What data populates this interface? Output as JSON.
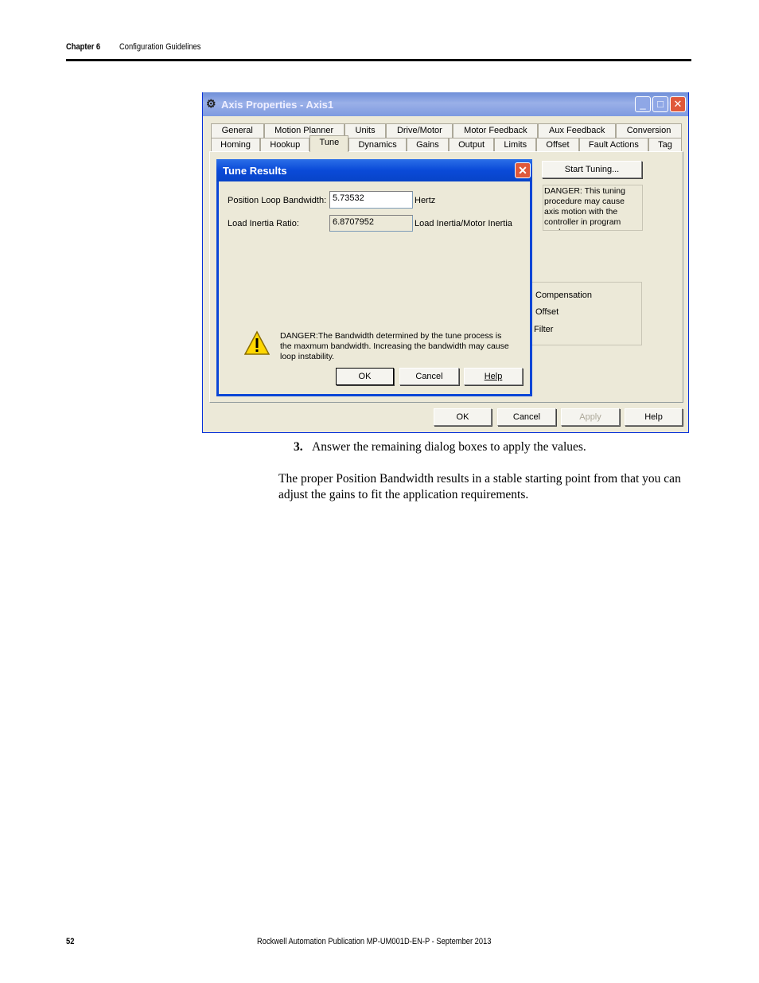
{
  "header": {
    "chapter": "Chapter 6",
    "section": "Configuration Guidelines"
  },
  "window": {
    "title": "Axis Properties - Axis1",
    "tabs_row1": [
      "General",
      "Motion Planner",
      "Units",
      "Drive/Motor",
      "Motor Feedback",
      "Aux Feedback",
      "Conversion"
    ],
    "tabs_row2": [
      "Homing",
      "Hookup",
      "Tune",
      "Dynamics",
      "Gains",
      "Output",
      "Limits",
      "Offset",
      "Fault Actions",
      "Tag"
    ],
    "selected_tab": "Tune",
    "start_tuning": "Start Tuning...",
    "danger_note": "DANGER: This tuning procedure may cause axis motion with the controller in program mode.",
    "group_items": [
      "Compensation",
      "Offset",
      "Filter"
    ],
    "buttons": {
      "ok": "OK",
      "cancel": "Cancel",
      "apply": "Apply",
      "help": "Help"
    }
  },
  "dialog": {
    "title": "Tune Results",
    "bandwidth_label": "Position Loop Bandwidth:",
    "bandwidth_value": "5.73532",
    "bandwidth_unit": "Hertz",
    "inertia_label": "Load Inertia Ratio:",
    "inertia_value": "6.8707952",
    "inertia_unit": "Load Inertia/Motor Inertia",
    "danger": "DANGER:The Bandwidth determined by the tune process is the maxmum bandwidth. Increasing the bandwidth may cause loop instability.",
    "buttons": {
      "ok": "OK",
      "cancel": "Cancel",
      "help": "Help"
    }
  },
  "body": {
    "step_number": "3.",
    "step_text": "Answer the remaining dialog boxes to apply the values.",
    "paragraph": "The proper Position Bandwidth results in a stable starting point from that you can adjust the gains to fit the application requirements."
  },
  "footer": {
    "page": "52",
    "publication": "Rockwell Automation Publication MP-UM001D-EN-P - September 2013"
  }
}
